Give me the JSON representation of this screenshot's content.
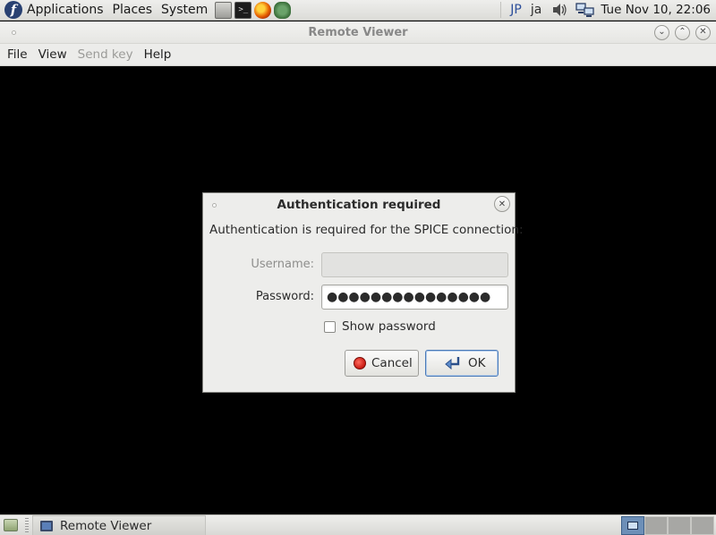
{
  "top_panel": {
    "logo_icon": "fedora-logo-icon",
    "menus": [
      "Applications",
      "Places",
      "System"
    ],
    "launchers": [
      "file-manager-icon",
      "terminal-icon",
      "firefox-icon",
      "network-icon"
    ],
    "keyboard_layout": "JP",
    "input_method": "ja",
    "clock": "Tue Nov 10, 22:06"
  },
  "window": {
    "title": "Remote Viewer",
    "menubar": [
      {
        "label": "File",
        "enabled": true
      },
      {
        "label": "View",
        "enabled": true
      },
      {
        "label": "Send key",
        "enabled": false
      },
      {
        "label": "Help",
        "enabled": true
      }
    ]
  },
  "dialog": {
    "title": "Authentication required",
    "message": "Authentication is required for the SPICE connection:",
    "username_label": "Username:",
    "username_value": "",
    "password_label": "Password:",
    "password_mask": "●●●●●●●●●●●●●●●",
    "show_password_label": "Show password",
    "show_password_checked": false,
    "cancel_label": "Cancel",
    "ok_label": "OK"
  },
  "bottom_panel": {
    "task_label": "Remote Viewer",
    "workspace_count": 4,
    "active_workspace": 1
  },
  "colors": {
    "panel_bg": "#e4e4e1",
    "viewer_bg": "#000000",
    "ok_border": "#4a7ab8",
    "keyboard_layout_text": "#2c4e9a"
  }
}
